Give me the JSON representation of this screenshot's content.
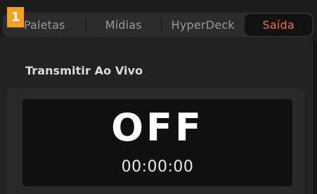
{
  "badge": {
    "number": "1",
    "color": "#f4a21e"
  },
  "tabs": [
    {
      "label": "Paletas",
      "active": false
    },
    {
      "label": "Mídias",
      "active": false
    },
    {
      "label": "HyperDeck",
      "active": false
    },
    {
      "label": "Saída",
      "active": true
    }
  ],
  "colors": {
    "accent": "#f0712e",
    "background": "#1c1c1c",
    "display_background": "#101010"
  },
  "section": {
    "title": "Transmitir Ao Vivo"
  },
  "stream": {
    "status": "OFF",
    "timecode": "00:00:00"
  }
}
